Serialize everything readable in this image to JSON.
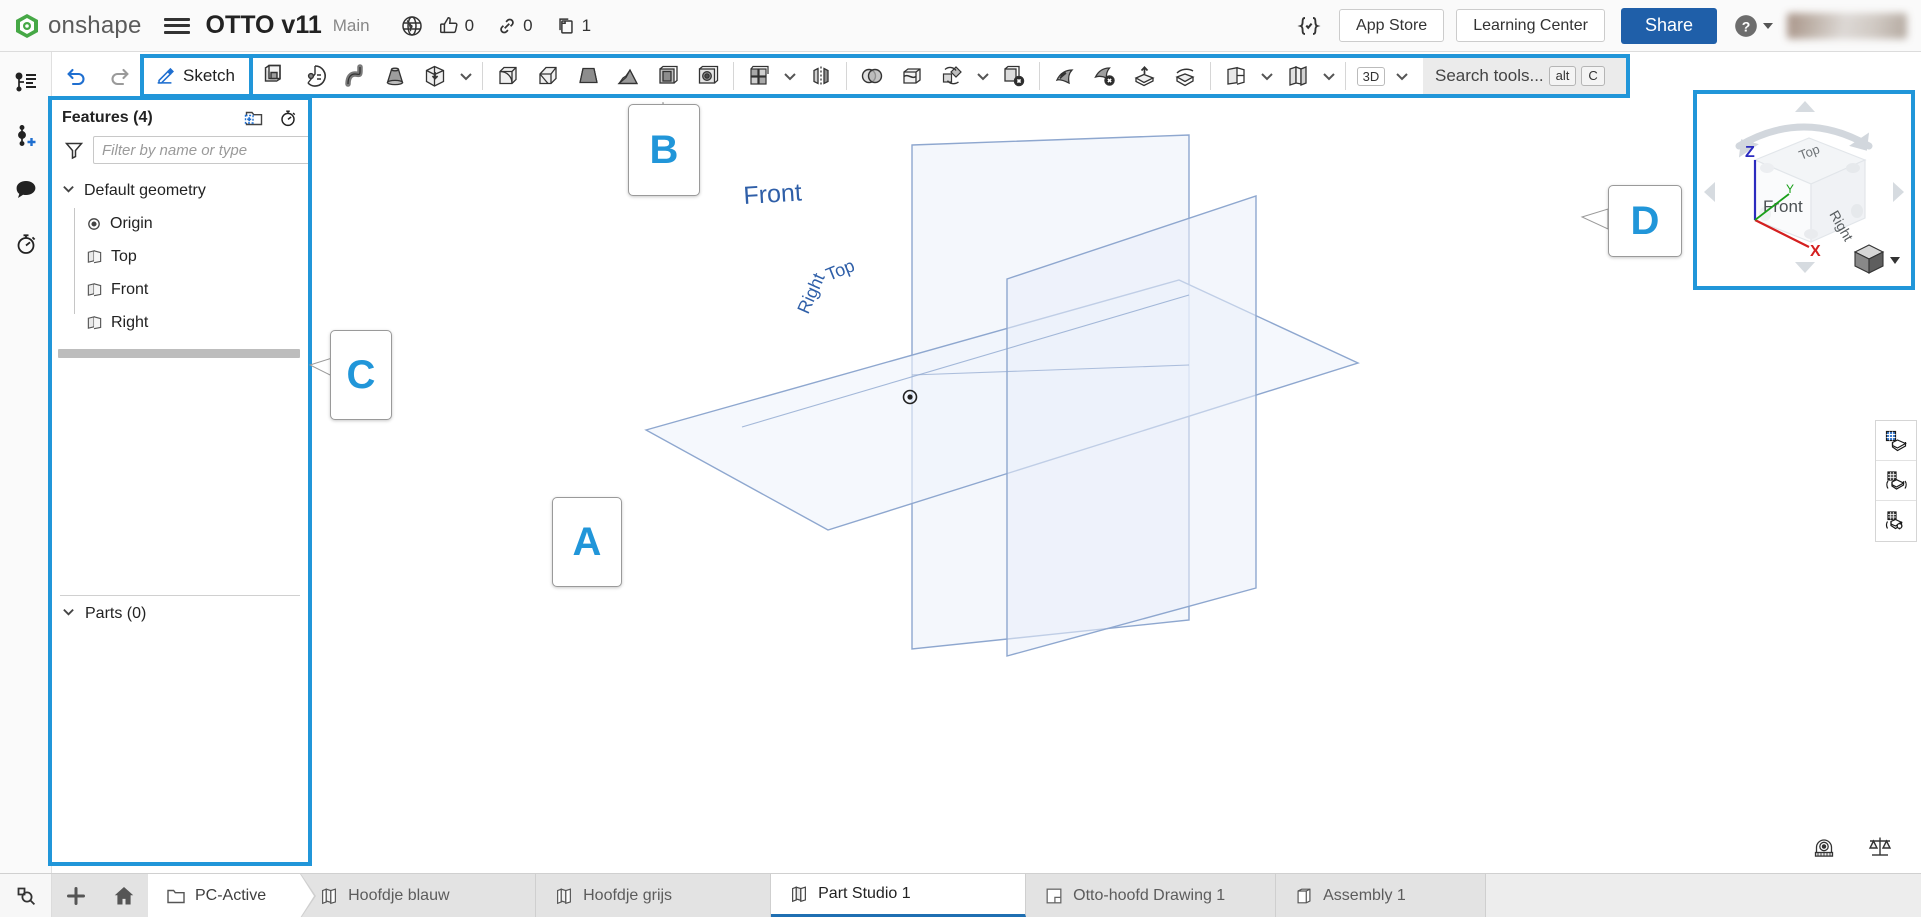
{
  "header": {
    "brand": "onshape",
    "brand_color": "#3aa03a",
    "menu_icon": "hamburger-icon",
    "document_title": "OTTO v11",
    "branch": "Main",
    "globe_icon": "globe-icon",
    "like_icon": "thumbs-up-icon",
    "like_count": "0",
    "link_icon": "link-icon",
    "link_count": "0",
    "copies_icon": "copy-icon",
    "copies_count": "1",
    "featurescript_icon": "featurescript-braces-icon",
    "app_store_label": "App Store",
    "learning_center_label": "Learning Center",
    "share_label": "Share",
    "share_color": "#1f5fa9",
    "help_icon": "help-circle-icon",
    "account_caret_icon": "chevron-down-icon",
    "avatar": "user-avatar"
  },
  "left_rail": {
    "items": [
      {
        "icon": "versions-and-history-icon",
        "name": "versions-graph"
      },
      {
        "icon": "add-version-icon",
        "name": "add-version"
      },
      {
        "icon": "comments-icon",
        "name": "comments"
      },
      {
        "icon": "activity-history-icon",
        "name": "history"
      }
    ]
  },
  "toolbar": {
    "undo_icon": "undo-icon",
    "redo_icon": "redo-icon",
    "sketch_label": "Sketch",
    "sketch_icon": "pencil-sketch-icon",
    "tools": [
      {
        "name": "extrude",
        "icon": "extrude-icon"
      },
      {
        "name": "revolve",
        "icon": "revolve-icon"
      },
      {
        "name": "sweep",
        "icon": "sweep-icon"
      },
      {
        "name": "loft",
        "icon": "loft-icon"
      },
      {
        "name": "more-create",
        "icon": "import-derive-icon",
        "caret": true
      },
      {
        "name": "fillet",
        "icon": "fillet-icon"
      },
      {
        "name": "chamfer",
        "icon": "chamfer-icon"
      },
      {
        "name": "draft",
        "icon": "draft-icon"
      },
      {
        "name": "rib",
        "icon": "rib-icon"
      },
      {
        "name": "shell",
        "icon": "shell-icon"
      },
      {
        "name": "hole",
        "icon": "hole-icon"
      },
      {
        "name": "linear-pattern",
        "icon": "pattern-icon",
        "caret": true
      },
      {
        "name": "mirror",
        "icon": "mirror-icon"
      },
      {
        "name": "boolean",
        "icon": "boolean-icon"
      },
      {
        "name": "split",
        "icon": "split-icon"
      },
      {
        "name": "transform",
        "icon": "transform-icon",
        "caret": true
      },
      {
        "name": "delete-part",
        "icon": "delete-part-icon"
      },
      {
        "name": "fill-surface",
        "icon": "fill-surface-icon"
      },
      {
        "name": "delete-face",
        "icon": "delete-face-icon"
      },
      {
        "name": "move-face",
        "icon": "move-face-icon"
      },
      {
        "name": "replace-face",
        "icon": "replace-face-icon"
      },
      {
        "name": "plane",
        "icon": "plane-icon",
        "caret": true
      },
      {
        "name": "sheet-metal",
        "icon": "sheet-metal-icon",
        "caret": true
      }
    ],
    "view_mode_label": "3D",
    "view_mode_caret": "chevron-down-icon",
    "search_placeholder": "Search tools...",
    "search_shortcut_alt": "alt",
    "search_shortcut_key": "C"
  },
  "feature_panel": {
    "title": "Features (4)",
    "new_folder_icon": "new-folder-icon",
    "history_icon": "feature-history-icon",
    "filter_icon": "filter-funnel-icon",
    "filter_placeholder": "Filter by name or type",
    "tree": [
      {
        "label": "Default geometry",
        "icon": "chevron-down-icon",
        "level": 0,
        "name": "tree-default-geometry"
      },
      {
        "label": "Origin",
        "icon": "origin-icon",
        "level": 1,
        "name": "tree-origin"
      },
      {
        "label": "Top",
        "icon": "plane-icon",
        "level": 1,
        "name": "tree-plane-top"
      },
      {
        "label": "Front",
        "icon": "plane-icon",
        "level": 1,
        "name": "tree-plane-front"
      },
      {
        "label": "Right",
        "icon": "plane-icon",
        "level": 1,
        "name": "tree-plane-right"
      }
    ],
    "parts_label": "Parts (0)",
    "parts_chevron": "chevron-down-icon",
    "collapse_handle_icon": "panel-collapse-icon"
  },
  "viewport": {
    "planes": [
      {
        "label": "Front",
        "name": "plane-front"
      },
      {
        "label": "Top",
        "name": "plane-top"
      },
      {
        "label": "Right",
        "name": "plane-right"
      }
    ],
    "origin_marker": "origin-point",
    "plane_stroke": "#8ea7cf",
    "plane_fill": "#eef2fa",
    "right_tools": [
      {
        "name": "display-state-panel",
        "icon": "grid-cube-icon"
      },
      {
        "name": "appearance-panel",
        "icon": "grid-cube-brackets-icon"
      },
      {
        "name": "render-panel",
        "icon": "grid-cube-gear-icon"
      }
    ],
    "bottom_tools": [
      {
        "name": "measure-tool",
        "icon": "tape-measure-icon"
      },
      {
        "name": "mass-properties-tool",
        "icon": "scales-icon"
      }
    ]
  },
  "view_cube": {
    "face_top": "Top",
    "face_front": "Front",
    "face_right": "Right",
    "axis_z": "Z",
    "axis_y": "Y",
    "axis_x": "X",
    "axis_z_color": "#2b2bbf",
    "axis_y_color": "#19a019",
    "axis_x_color": "#d42020",
    "view_style_icon": "shaded-cube-icon",
    "view_style_caret": "chevron-down-icon"
  },
  "callouts": [
    {
      "letter": "A",
      "name": "callout-a-viewport"
    },
    {
      "letter": "B",
      "name": "callout-b-toolbar"
    },
    {
      "letter": "C",
      "name": "callout-c-feature-list"
    },
    {
      "letter": "D",
      "name": "callout-d-view-cube"
    }
  ],
  "callout_color": "#2196d9",
  "tabs": {
    "search_icon": "tab-search-icon",
    "add_icon": "add-tab-icon",
    "home_icon": "home-icon",
    "items": [
      {
        "label": "PC-Active",
        "icon": "folder-icon",
        "name": "tab-pc-active",
        "type": "breadcrumb",
        "active": false
      },
      {
        "label": "Hoofdje blauw",
        "icon": "part-studio-icon",
        "name": "tab-hoofdje-blauw",
        "type": "part-studio",
        "active": false
      },
      {
        "label": "Hoofdje grijs",
        "icon": "part-studio-icon",
        "name": "tab-hoofdje-grijs",
        "type": "part-studio",
        "active": false
      },
      {
        "label": "Part Studio 1",
        "icon": "part-studio-icon",
        "name": "tab-part-studio-1",
        "type": "part-studio",
        "active": true
      },
      {
        "label": "Otto-hoofd Drawing 1",
        "icon": "drawing-icon",
        "name": "tab-otto-hoofd-drawing-1",
        "type": "drawing",
        "active": false
      },
      {
        "label": "Assembly 1",
        "icon": "assembly-icon",
        "name": "tab-assembly-1",
        "type": "assembly",
        "active": false
      }
    ]
  }
}
